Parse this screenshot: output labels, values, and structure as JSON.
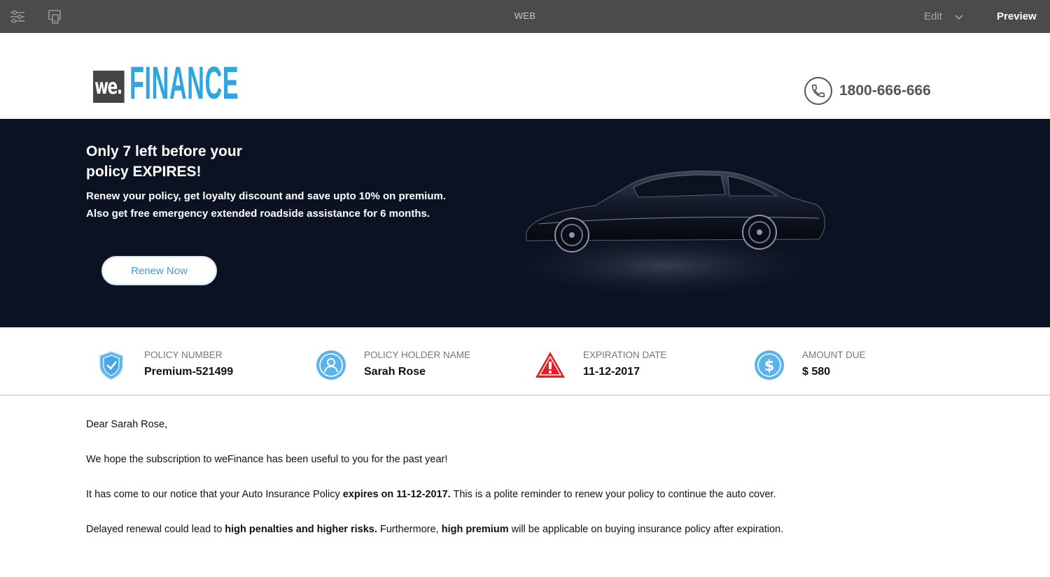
{
  "toolbar": {
    "title": "WEB",
    "edit_label": "Edit",
    "preview_label": "Preview",
    "icons": [
      "sliders-icon",
      "device-preview-icon",
      "chevron-down-icon"
    ]
  },
  "header": {
    "logo_we": "we.",
    "logo_finance": "FINANCE",
    "phone": "1800-666-666"
  },
  "hero": {
    "title_line1": "Only 7 left before your",
    "title_line2": "policy EXPIRES!",
    "text_line1": "Renew your policy, get loyalty discount and save upto 10% on premium.",
    "text_line2": "Also get free emergency extended roadside assistance for 6 months.",
    "button_label": "Renew Now"
  },
  "info": {
    "policy_number": {
      "label": "POLICY NUMBER",
      "value": "Premium-521499",
      "icon": "shield-check-icon"
    },
    "holder_name": {
      "label": "POLICY HOLDER NAME",
      "value": "Sarah Rose",
      "icon": "user-circle-icon"
    },
    "expiration": {
      "label": "EXPIRATION DATE",
      "value": "11-12-2017",
      "icon": "warning-triangle-icon"
    },
    "amount_due": {
      "label": "AMOUNT DUE",
      "value": "$ 580",
      "icon": "dollar-circle-icon"
    }
  },
  "letter": {
    "greeting": "Dear Sarah Rose,",
    "p1": "We hope the subscription to weFinance has been useful to you for the past year!",
    "p2_a": "It has come to our notice that your Auto Insurance Policy ",
    "p2_b": "expires on 11-12-2017.",
    "p2_c": " This is a polite reminder to renew your policy to continue the auto cover.",
    "p3_a": "Delayed renewal could lead to ",
    "p3_b": "high penalties and higher risks.",
    "p3_c": " Furthermore, ",
    "p3_d": "high premium",
    "p3_e": " will be applicable on buying insurance policy after expiration."
  },
  "colors": {
    "toolbar_bg": "#4b4b4b",
    "hero_bg": "#0b1221",
    "brand_blue": "#2fa6e0",
    "warning_red": "#e31e24"
  }
}
